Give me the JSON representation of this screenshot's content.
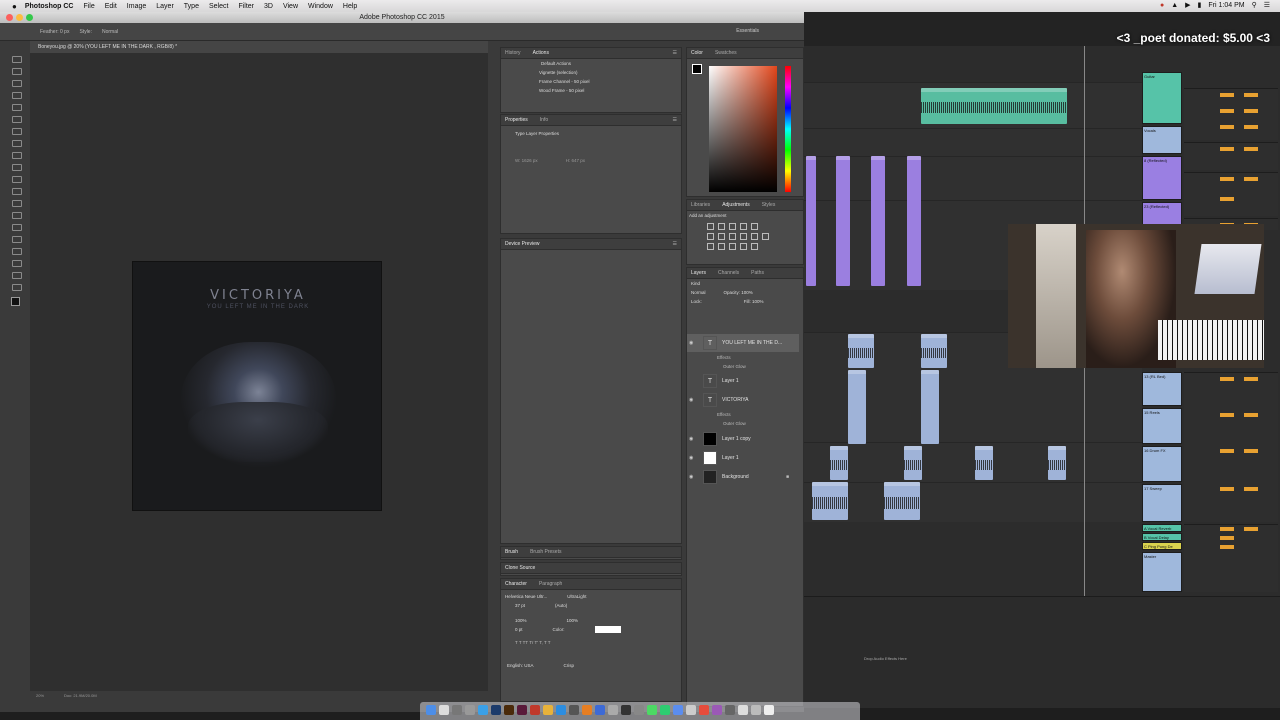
{
  "menubar": {
    "app": "Photoshop CC",
    "items": [
      "File",
      "Edit",
      "Image",
      "Layer",
      "Type",
      "Select",
      "Filter",
      "3D",
      "View",
      "Window",
      "Help"
    ],
    "clock": "Fri 1:04 PM"
  },
  "photoshop": {
    "window_title": "Adobe Photoshop CC 2015",
    "options": {
      "feather": "Feather: 0 px",
      "style_label": "Style:",
      "style_value": "Normal",
      "workspace": "Essentials"
    },
    "document_tab": "Boneyou.jpg @ 20% (YOU LEFT ME IN THE DARK , RGB/8) *",
    "status": {
      "zoom": "20%",
      "doc": "Doc: 21.9M/20.0M"
    },
    "artwork": {
      "title": "VICTORIYA",
      "subtitle": "YOU LEFT ME IN THE DARK"
    },
    "history_tabs": [
      "History",
      "Actions"
    ],
    "actions": [
      "Default Actions",
      "Vignette (selection)",
      "Frame Channel - 50 pixel",
      "Wood Frame - 50 pixel"
    ],
    "properties_tabs": [
      "Properties",
      "Info"
    ],
    "properties_title": "Type Layer Properties",
    "properties_w": "W: 1626 px",
    "properties_h": "H: 647 px",
    "device_preview": "Device Preview",
    "brush_tabs": [
      "Brush",
      "Brush Presets"
    ],
    "clone_source": "Clone Source",
    "character_tabs": [
      "Character",
      "Paragraph"
    ],
    "character": {
      "font": "Helvetica Neue Ultr...",
      "weight": "UltraLight",
      "size": "37 pt",
      "leading": "(Auto)",
      "scale_v": "100%",
      "scale_h": "100%",
      "baseline": "0 pt",
      "color_label": "Color:",
      "language": "English: USA",
      "aa": "Crisp"
    },
    "color_tabs": [
      "Color",
      "Swatches"
    ],
    "adjust_tabs": [
      "Libraries",
      "Adjustments",
      "Styles"
    ],
    "adjust_hint": "Add an adjustment",
    "layers_tabs": [
      "Layers",
      "Channels",
      "Paths"
    ],
    "layers_kind": "Kind",
    "layers_blend": "Normal",
    "layers_opacity": "Opacity: 100%",
    "layers_lock": "Lock:",
    "layers_fill": "Fill: 100%",
    "layers": [
      {
        "name": "YOU LEFT ME IN THE D...",
        "type": "T",
        "selected": true
      },
      {
        "name": "Effects",
        "sub": true
      },
      {
        "name": "Outer Glow",
        "sub": true
      },
      {
        "name": "Layer 1",
        "type": "T"
      },
      {
        "name": "VICTORIYA",
        "type": "T"
      },
      {
        "name": "Effects",
        "sub": true
      },
      {
        "name": "Outer Glow",
        "sub": true
      },
      {
        "name": "Layer 1 copy",
        "type": "black"
      },
      {
        "name": "Layer 1",
        "type": "white"
      },
      {
        "name": "Background",
        "type": "img"
      }
    ]
  },
  "daw": {
    "donation": "<3 _poet donated: $5.00 <3",
    "drop_hint": "Drop Audio Effects Here",
    "tracks": [
      {
        "name": "Guitar",
        "color": "green"
      },
      {
        "name": "Vocals",
        "color": "blue"
      },
      {
        "name": "8 (Reflected)",
        "color": "purple"
      },
      {
        "name": "23 (Reflected)",
        "color": "purple"
      },
      {
        "name": "13 (RL Bed)",
        "color": "blue"
      },
      {
        "name": "15 Reels",
        "color": "blue"
      },
      {
        "name": "16 Drum FX",
        "color": "blue"
      },
      {
        "name": "17 Sweep",
        "color": "blue"
      },
      {
        "name": "A Vocal Reverb",
        "color": "green"
      },
      {
        "name": "B Vocal Delay",
        "color": "green"
      },
      {
        "name": "C Ping Pong De",
        "color": "yellow"
      },
      {
        "name": "Master",
        "color": "blue"
      }
    ]
  }
}
